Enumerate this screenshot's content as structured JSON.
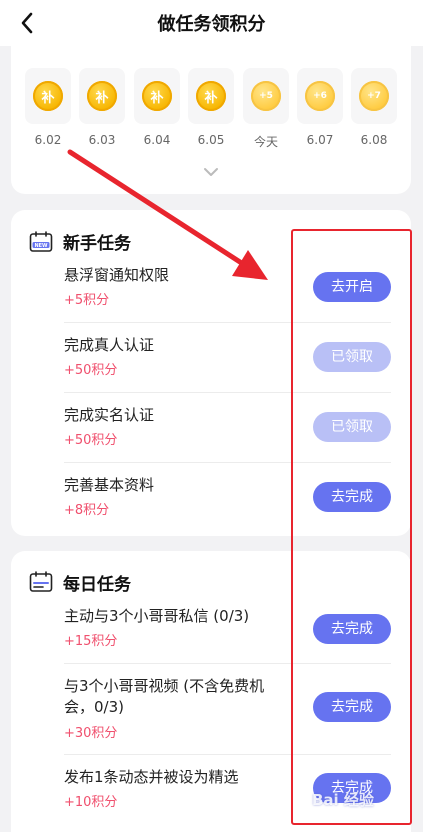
{
  "header": {
    "title": "做任务领积分",
    "back_icon": "chevron-left-icon"
  },
  "checkin": {
    "days": [
      {
        "coin": "补",
        "label": "6.02"
      },
      {
        "coin": "补",
        "label": "6.03"
      },
      {
        "coin": "补",
        "label": "6.04"
      },
      {
        "coin": "补",
        "label": "6.05"
      },
      {
        "coin": "+5",
        "label": "今天"
      },
      {
        "coin": "+6",
        "label": "6.07"
      },
      {
        "coin": "+7",
        "label": "6.08"
      }
    ],
    "expand_icon": "chevron-down-icon"
  },
  "newbie": {
    "title": "新手任务",
    "icon": "calendar-new-icon",
    "icon_badge": "NEW",
    "tasks": [
      {
        "name": "悬浮窗通知权限",
        "reward": "+5积分",
        "button": "去开启",
        "done": false
      },
      {
        "name": "完成真人认证",
        "reward": "+50积分",
        "button": "已领取",
        "done": true
      },
      {
        "name": "完成实名认证",
        "reward": "+50积分",
        "button": "已领取",
        "done": true
      },
      {
        "name": "完善基本资料",
        "reward": "+8积分",
        "button": "去完成",
        "done": false
      }
    ]
  },
  "daily": {
    "title": "每日任务",
    "icon": "calendar-icon",
    "tasks": [
      {
        "name": "主动与3个小哥哥私信 (0/3)",
        "reward": "+15积分",
        "button": "去完成",
        "done": false
      },
      {
        "name": "与3个小哥哥视频 (不含免费机会，0/3)",
        "reward": "+30积分",
        "button": "去完成",
        "done": false
      },
      {
        "name": "发布1条动态并被设为精选",
        "reward": "+10积分",
        "button": "去完成",
        "done": false
      }
    ]
  },
  "annotation": {
    "color": "#e8252e"
  },
  "watermark": {
    "text": "Bai 经验"
  },
  "colors": {
    "accent": "#6673f0",
    "accent_disabled": "#b9c0f6",
    "reward": "#f0506e",
    "coin": "#f7b500"
  }
}
